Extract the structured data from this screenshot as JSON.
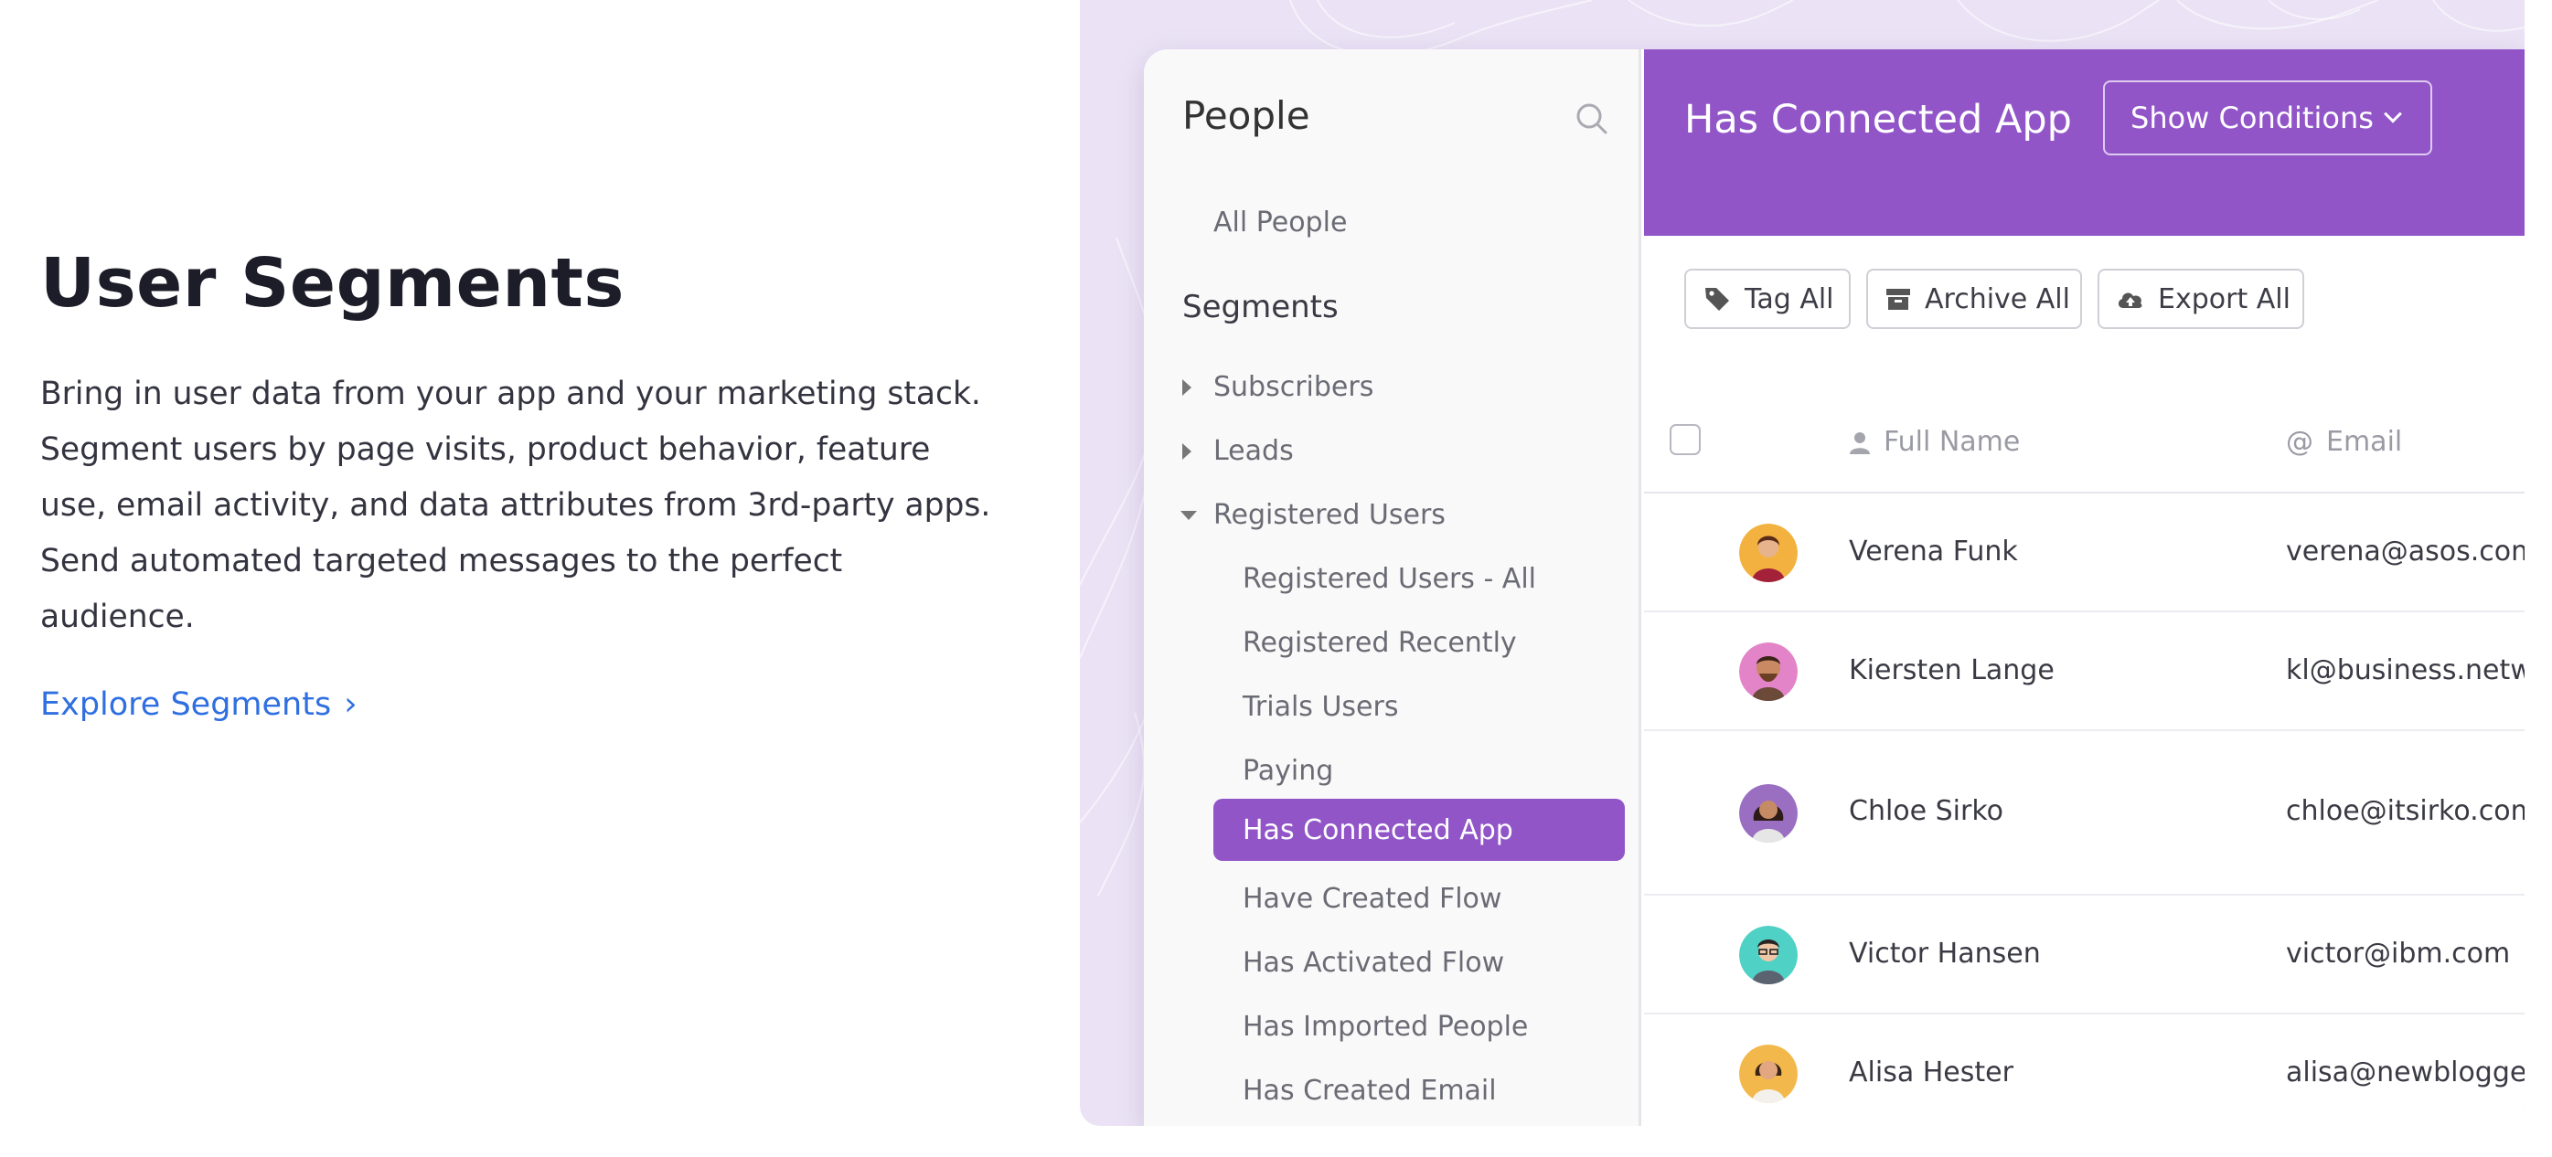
{
  "copy": {
    "title": "User Segments",
    "body_lines": [
      "Bring in user data from your app and your marketing stack.",
      "Segment users by page visits, product behavior, feature",
      "use, email activity, and data attributes from 3rd-party apps.",
      "Send automated targeted messages to the perfect",
      "audience."
    ],
    "link_label": "Explore Segments",
    "link_chevron": "›"
  },
  "sidebar": {
    "title": "People",
    "all_people": "All People",
    "section": "Segments",
    "groups": [
      "Subscribers",
      "Leads",
      "Registered Users"
    ],
    "registered_items": [
      "Registered Users - All",
      "Registered Recently",
      "Trials Users",
      "Paying",
      "Has Connected App",
      "Have Created Flow",
      "Has Activated Flow",
      "Has Imported People",
      "Has Created Email"
    ],
    "active_item": "Has Connected App"
  },
  "main": {
    "title": "Has Connected App",
    "show_conditions": "Show Conditions",
    "actions": [
      "Tag All",
      "Archive All",
      "Export All"
    ],
    "columns": [
      "Full Name",
      "Email"
    ],
    "rows": [
      {
        "name": "Verena Funk",
        "email": "verena@asos.com"
      },
      {
        "name": "Kiersten Lange",
        "email": "kl@business.netwo"
      },
      {
        "name": "Chloe Sirko",
        "email": "chloe@itsirko.com"
      },
      {
        "name": "Victor Hansen",
        "email": "victor@ibm.com"
      },
      {
        "name": "Alisa Hester",
        "email": "alisa@newblogger.c"
      }
    ]
  },
  "colors": {
    "accent": "#9155c8",
    "link": "#2f6fe0",
    "panel_bg": "#ebe3f5"
  },
  "icons": [
    "search-icon",
    "tag-icon",
    "archive-icon",
    "cloud-upload-icon",
    "person-icon",
    "at-icon",
    "caret-right-icon",
    "caret-down-icon",
    "chevron-down-icon",
    "chevron-right-icon"
  ]
}
